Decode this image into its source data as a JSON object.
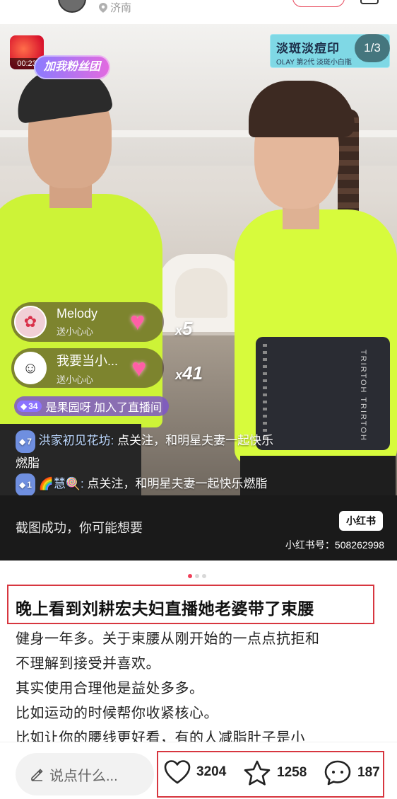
{
  "header": {
    "location": "济南"
  },
  "live": {
    "duration": "00:23",
    "fans_badge": "加我粉丝团",
    "promo_title": "淡斑淡痘印",
    "promo_sub": "OLAY 第2代 淡斑小白瓶",
    "page_indicator": "1/3",
    "belt_text": "TRIRTOH TRIRTOH",
    "gifts": [
      {
        "name": "Melody",
        "sub": "送小心心",
        "count_prefix": "x",
        "count": "5"
      },
      {
        "name": "我要当小...",
        "sub": "送小心心",
        "count_prefix": "x",
        "count": "41"
      }
    ],
    "join": {
      "level": "34",
      "text": "是果园呀 加入了直播间"
    },
    "chat": [
      {
        "level": "7",
        "user": "洪家初见花坊:",
        "message": "点关注，和明星夫妻一起快乐",
        "message2": "燃脂"
      },
      {
        "level": "1",
        "user": "🌈慧🍭:",
        "message": "点关注，和明星夫妻一起快乐燃脂"
      }
    ]
  },
  "screenshot_bar": {
    "text": "截图成功，你可能想要",
    "logo": "小红书",
    "id": "小红书号：508262998"
  },
  "post": {
    "title": "晚上看到刘耕宏夫妇直播她老婆带了束腰",
    "lines": [
      "健身一年多。关于束腰从刚开始的一点点抗拒和",
      "不理解到接受并喜欢。",
      "其实使用合理他是益处多多。",
      "比如运动的时候帮你收紧核心。",
      "比如让你的腰线更好看，有的人减脂肚子是小"
    ]
  },
  "bottom_bar": {
    "comment_placeholder": "说点什么...",
    "likes": "3204",
    "stars": "1258",
    "comments": "187"
  },
  "colors": {
    "accent": "#d7363f",
    "brand": "#f0405a",
    "shirt": "#d7fb3c"
  }
}
